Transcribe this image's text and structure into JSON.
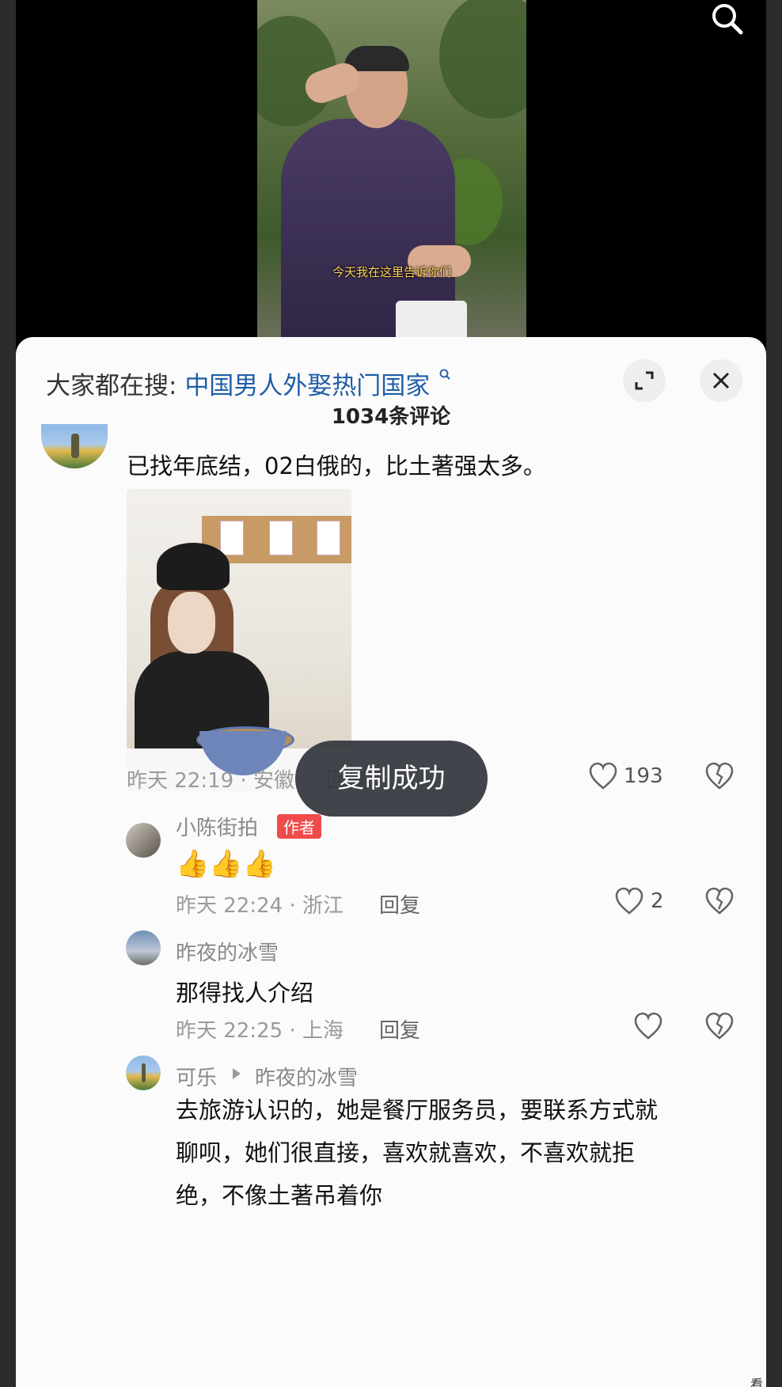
{
  "video": {
    "subtitle": "今天我在这里告诉你们"
  },
  "sheet": {
    "search_prefix": "大家都在搜:",
    "search_link": "中国男人外娶热门国家",
    "comment_count": "1034条评论"
  },
  "toast": "复制成功",
  "comment": {
    "text": "已找年底结，02白俄的，比土著强太多。",
    "meta": "昨天 22:19 · 安徽",
    "reply_label": "回复",
    "likes": "193"
  },
  "replies": [
    {
      "username": "小陈街拍",
      "badge": "作者",
      "text": "👍👍👍",
      "meta": "昨天 22:24 · 浙江",
      "reply_label": "回复",
      "likes": "2"
    },
    {
      "username": "昨夜的冰雪",
      "text": "那得找人介绍",
      "meta": "昨天 22:25 · 上海",
      "reply_label": "回复",
      "likes": ""
    },
    {
      "username": "可乐",
      "reply_to": "昨夜的冰雪",
      "text_lines": [
        "去旅游认识的，她是餐厅服务员，要联系方式就",
        "聊呗，她们很直接，喜欢就喜欢，不喜欢就拒",
        "绝，不像土著吊着你"
      ]
    }
  ],
  "watermark": "看"
}
